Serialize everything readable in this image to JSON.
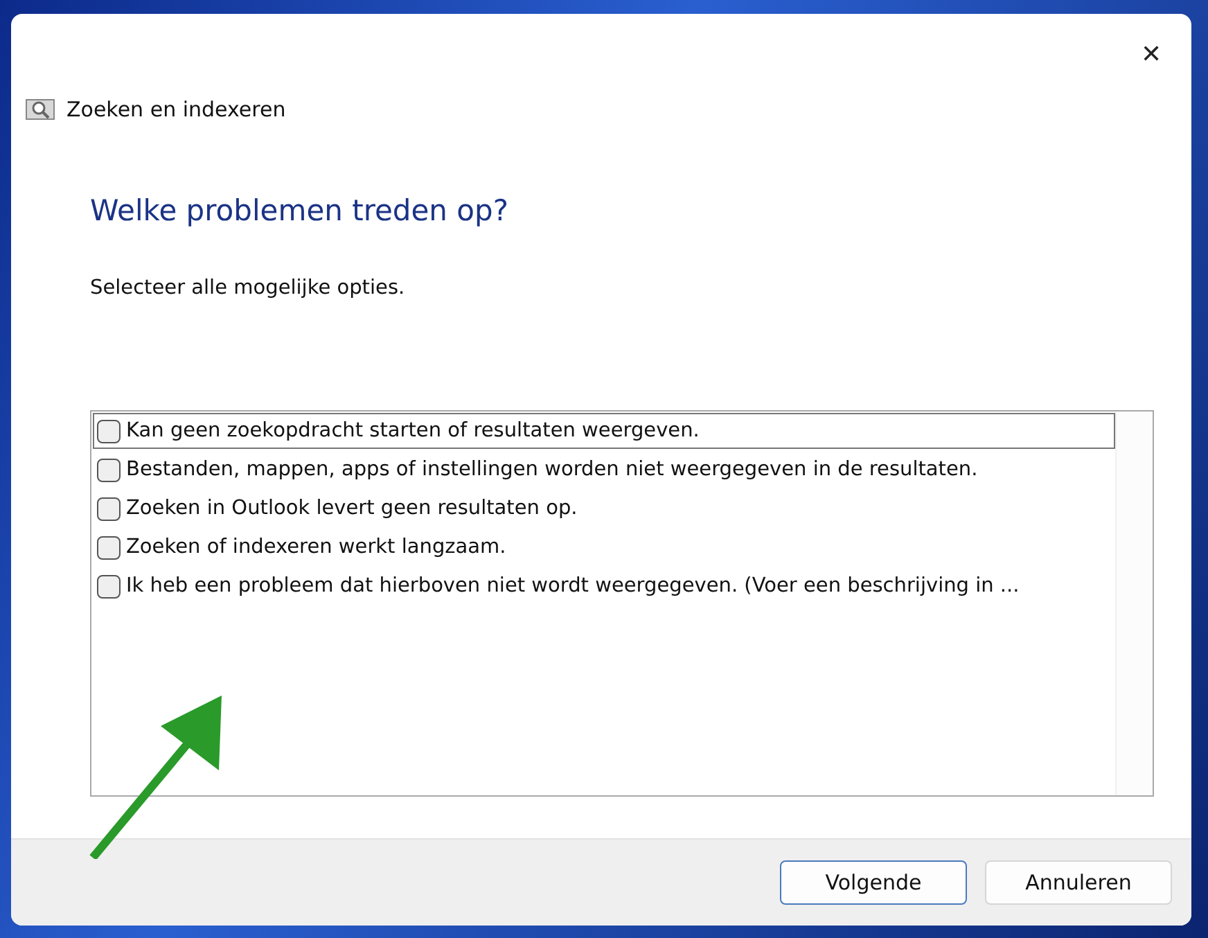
{
  "window": {
    "title": "Zoeken en indexeren",
    "close": "✕"
  },
  "heading": "Welke problemen treden op?",
  "instruction": "Selecteer alle mogelijke opties.",
  "options": [
    {
      "label": "Kan geen zoekopdracht starten of resultaten weergeven.",
      "checked": false,
      "focused": true
    },
    {
      "label": "Bestanden, mappen, apps of instellingen worden niet weergegeven in de resultaten.",
      "checked": false,
      "focused": false
    },
    {
      "label": "Zoeken in Outlook levert geen resultaten op.",
      "checked": false,
      "focused": false
    },
    {
      "label": "Zoeken of indexeren werkt langzaam.",
      "checked": false,
      "focused": false
    },
    {
      "label": "Ik heb een probleem dat hierboven niet wordt weergegeven. (Voer een beschrijving in ...",
      "checked": false,
      "focused": false
    }
  ],
  "buttons": [
    {
      "label": "Volgende",
      "kind": "default"
    },
    {
      "label": "Annuleren",
      "kind": "normal"
    }
  ]
}
